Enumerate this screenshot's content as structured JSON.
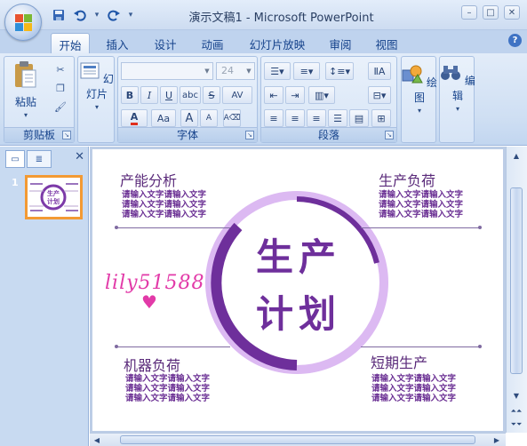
{
  "window": {
    "title": "演示文稿1 - Microsoft PowerPoint"
  },
  "quick_access": {
    "icons": [
      "save-icon",
      "undo-icon",
      "redo-icon",
      "customize-icon"
    ]
  },
  "tabs": [
    {
      "label": "开始",
      "active": true
    },
    {
      "label": "插入"
    },
    {
      "label": "设计"
    },
    {
      "label": "动画"
    },
    {
      "label": "幻灯片放映"
    },
    {
      "label": "审阅"
    },
    {
      "label": "视图"
    }
  ],
  "ribbon": {
    "clipboard": {
      "paste_label": "粘贴",
      "group_label": "剪贴板"
    },
    "slides": {
      "new_slide_label": "幻灯片"
    },
    "font": {
      "font_name": "",
      "font_size": "24",
      "group_label": "字体",
      "bold": "B",
      "italic": "I",
      "underline": "U",
      "shadow": "abc",
      "strike": "S",
      "spacing": "AV",
      "case": "Aa",
      "grow": "A",
      "shrink": "A"
    },
    "paragraph": {
      "group_label": "段落"
    },
    "drawing": {
      "label": "绘图"
    },
    "editing": {
      "label": "编辑"
    }
  },
  "slides_panel": {
    "slide_number": "1",
    "thumb_title": "生产计划"
  },
  "slide": {
    "center_line1": "生产",
    "center_line2": "计划",
    "sections": [
      {
        "title": "产能分析",
        "lines": [
          "请输入文字请输入文字",
          "请输入文字请输入文字",
          "请输入文字请输入文字"
        ]
      },
      {
        "title": "生产负荷",
        "lines": [
          "请输入文字请输入文字",
          "请输入文字请输入文字",
          "请输入文字请输入文字"
        ]
      },
      {
        "title": "机器负荷",
        "lines": [
          "请输入文字请输入文字",
          "请输入文字请输入文字",
          "请输入文字请输入文字"
        ]
      },
      {
        "title": "短期生产",
        "lines": [
          "请输入文字请输入文字",
          "请输入文字请输入文字",
          "请输入文字请输入文字"
        ]
      }
    ],
    "watermark": "lily51588",
    "colors": {
      "ring_dark": "#6e2f9b",
      "ring_light": "#d8b8ee",
      "text": "#6e2f9b"
    }
  }
}
